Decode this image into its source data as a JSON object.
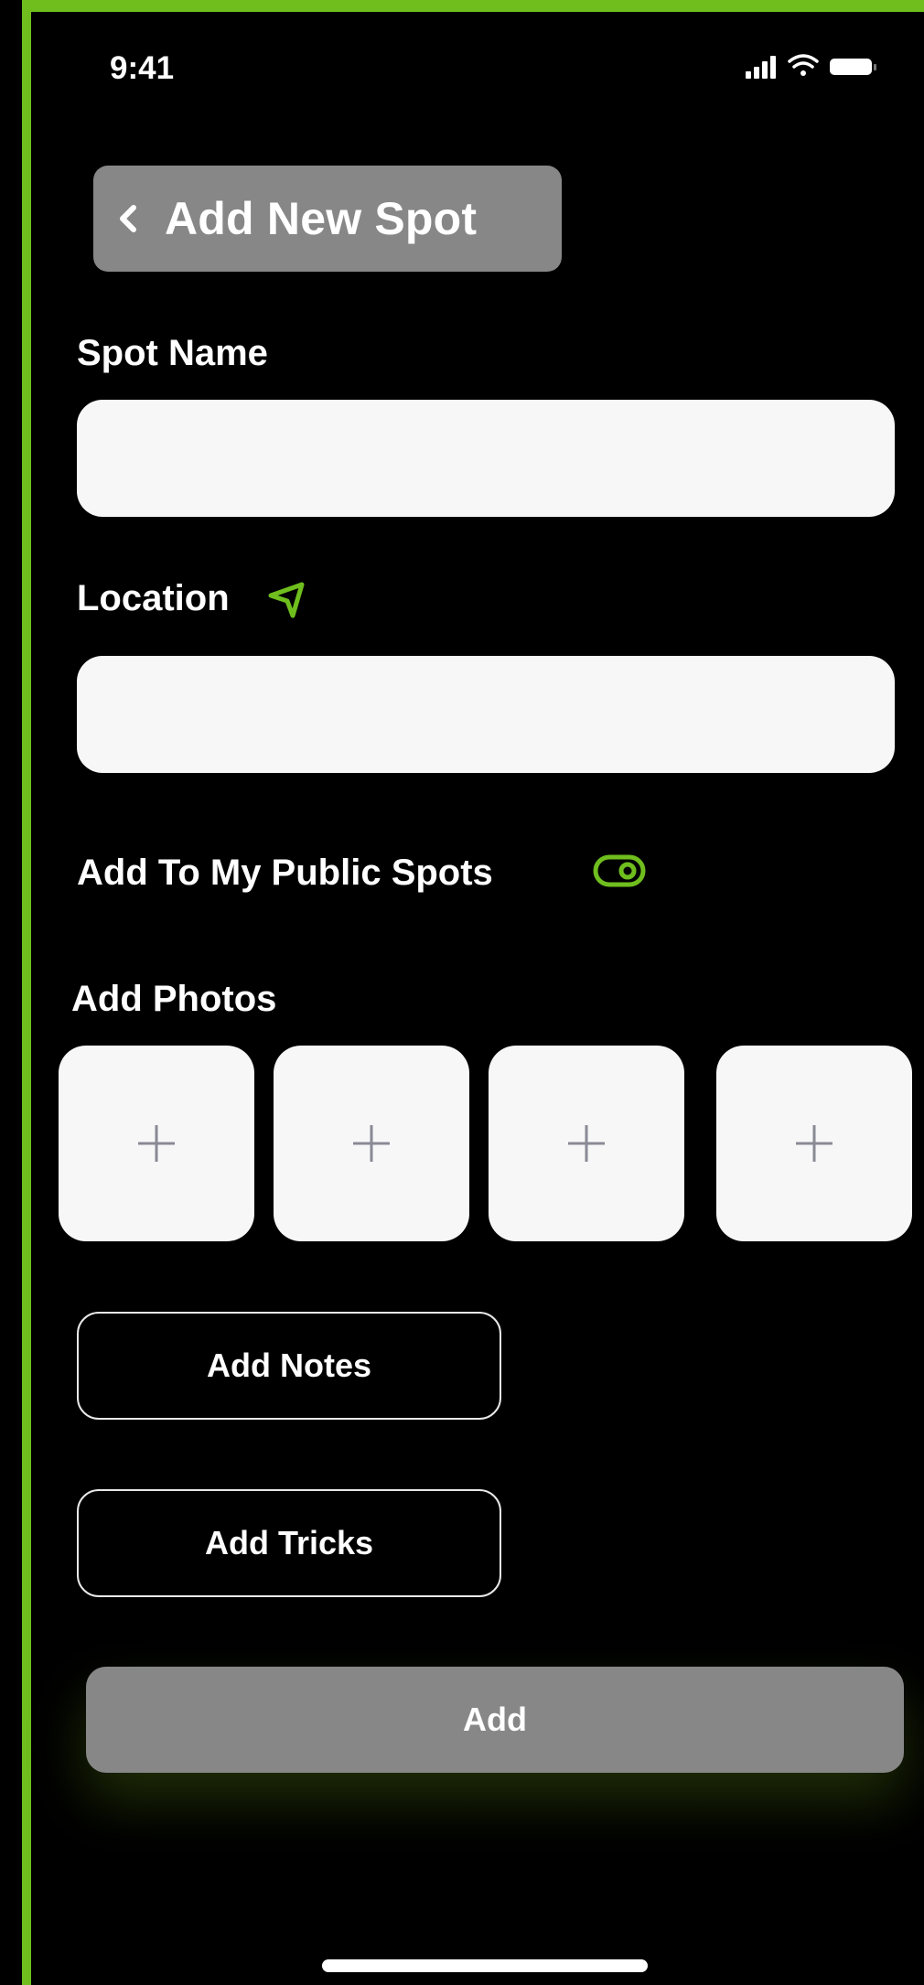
{
  "status_bar": {
    "time": "9:41",
    "icons": [
      "cellular-signal-icon",
      "wifi-icon",
      "battery-icon"
    ]
  },
  "header": {
    "back_icon": "chevron-left-icon",
    "title": "Add New Spot"
  },
  "form": {
    "spot_name": {
      "label": "Spot  Name",
      "value": "",
      "placeholder": ""
    },
    "location": {
      "label": "Location",
      "icon": "location-arrow-icon",
      "value": "",
      "placeholder": ""
    },
    "public_spots": {
      "label": "Add To My Public Spots",
      "toggle_on": true
    }
  },
  "photos": {
    "label": "Add Photos",
    "tiles": [
      "+",
      "+",
      "+",
      "+"
    ]
  },
  "buttons": {
    "notes": "Add Notes",
    "tricks": "Add Tricks",
    "add": "Add"
  },
  "colors": {
    "accent_green": "#6fbe1e",
    "button_gray": "#878787",
    "input_bg": "#f7f7f8",
    "background": "#000000"
  }
}
